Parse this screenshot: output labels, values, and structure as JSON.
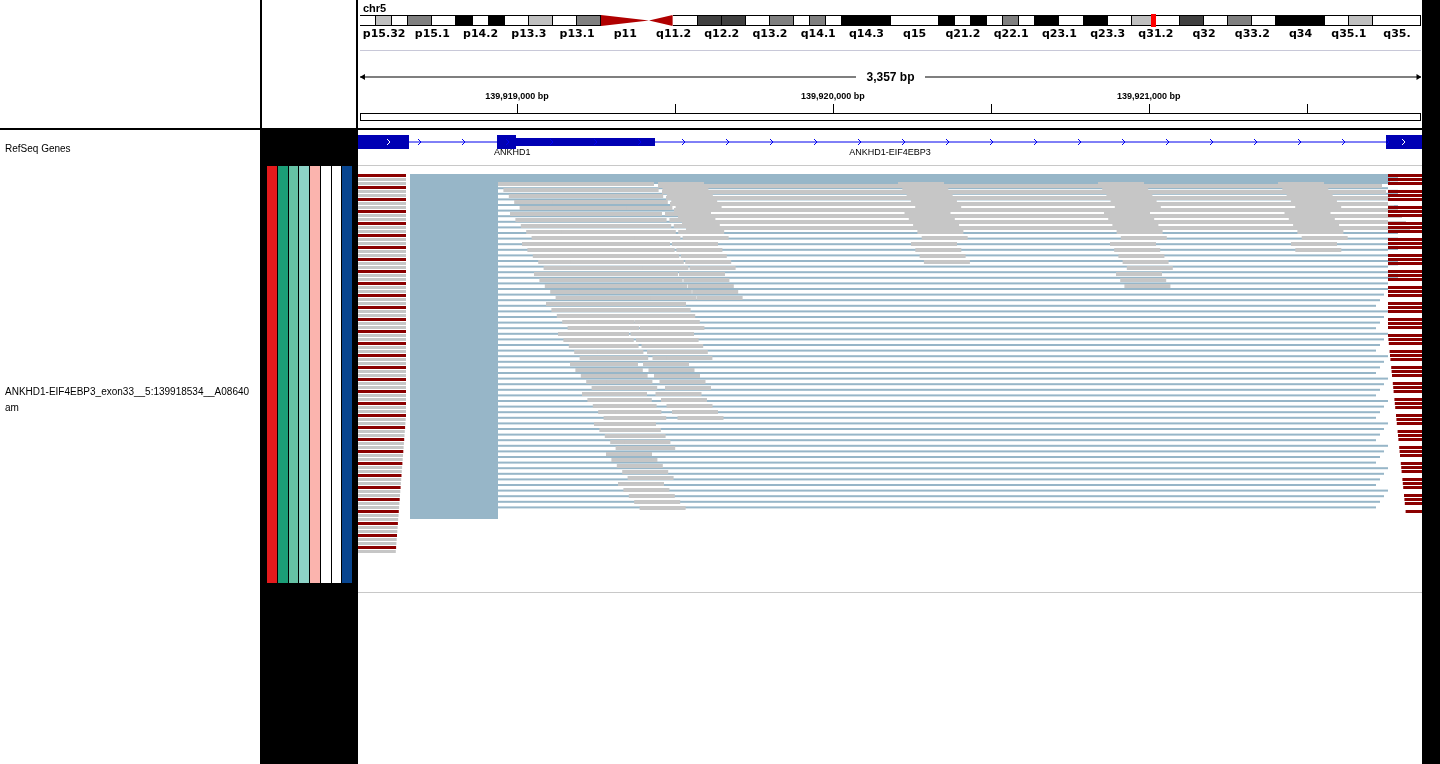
{
  "chromosome": "chr5",
  "cytobands": [
    {
      "label": "p15.32",
      "stains": [
        {
          "kind": "white"
        },
        {
          "kind": "light"
        },
        {
          "kind": "white"
        }
      ],
      "marked": false
    },
    {
      "label": "p15.1",
      "stains": [
        {
          "kind": "gray"
        },
        {
          "kind": "white"
        }
      ],
      "marked": false
    },
    {
      "label": "p14.2",
      "stains": [
        {
          "kind": "black"
        },
        {
          "kind": "white"
        },
        {
          "kind": "black"
        }
      ],
      "marked": false
    },
    {
      "label": "p13.3",
      "stains": [
        {
          "kind": "white"
        },
        {
          "kind": "light"
        }
      ],
      "marked": false
    },
    {
      "label": "p13.1",
      "stains": [
        {
          "kind": "white"
        },
        {
          "kind": "gray"
        }
      ],
      "marked": false
    },
    {
      "label": "p11",
      "stains": [
        {
          "kind": "acen_p"
        }
      ],
      "marked": false
    },
    {
      "label": "q11.2",
      "stains": [
        {
          "kind": "acen_q"
        },
        {
          "kind": "white"
        }
      ],
      "marked": false
    },
    {
      "label": "q12.2",
      "stains": [
        {
          "kind": "dark"
        },
        {
          "kind": "dark"
        }
      ],
      "marked": false
    },
    {
      "label": "q13.2",
      "stains": [
        {
          "kind": "white"
        },
        {
          "kind": "gray"
        }
      ],
      "marked": false
    },
    {
      "label": "q14.1",
      "stains": [
        {
          "kind": "white"
        },
        {
          "kind": "gray"
        },
        {
          "kind": "white"
        }
      ],
      "marked": false
    },
    {
      "label": "q14.3",
      "stains": [
        {
          "kind": "black"
        }
      ],
      "marked": false
    },
    {
      "label": "q15",
      "stains": [
        {
          "kind": "white"
        }
      ],
      "marked": false
    },
    {
      "label": "q21.2",
      "stains": [
        {
          "kind": "black"
        },
        {
          "kind": "white"
        },
        {
          "kind": "black"
        }
      ],
      "marked": false
    },
    {
      "label": "q22.1",
      "stains": [
        {
          "kind": "white"
        },
        {
          "kind": "gray"
        },
        {
          "kind": "white"
        }
      ],
      "marked": false
    },
    {
      "label": "q23.1",
      "stains": [
        {
          "kind": "black"
        },
        {
          "kind": "white"
        }
      ],
      "marked": false
    },
    {
      "label": "q23.3",
      "stains": [
        {
          "kind": "black"
        },
        {
          "kind": "white"
        }
      ],
      "marked": false
    },
    {
      "label": "q31.2",
      "stains": [
        {
          "kind": "light"
        },
        {
          "kind": "white"
        }
      ],
      "marked": true
    },
    {
      "label": "q32",
      "stains": [
        {
          "kind": "dark"
        },
        {
          "kind": "white"
        }
      ],
      "marked": false
    },
    {
      "label": "q33.2",
      "stains": [
        {
          "kind": "gray"
        },
        {
          "kind": "white"
        }
      ],
      "marked": false
    },
    {
      "label": "q34",
      "stains": [
        {
          "kind": "black"
        }
      ],
      "marked": false
    },
    {
      "label": "q35.1",
      "stains": [
        {
          "kind": "white"
        },
        {
          "kind": "light"
        }
      ],
      "marked": false
    },
    {
      "label": "q35.",
      "stains": [
        {
          "kind": "white"
        }
      ],
      "marked": false
    }
  ],
  "span": "3,357 bp",
  "ticks": [
    "139,919,000 bp",
    "139,920,000 bp",
    "139,921,000 bp"
  ],
  "tracks": [
    {
      "kind": "genes",
      "name_lines": [
        "RefSeq Genes"
      ],
      "genes": [
        "ANKHD1",
        "ANKHD1-EIF4EBP3"
      ]
    },
    {
      "kind": "alignments",
      "name_lines": [
        "ANKHD1-EIF4EBP3_exon33__5:139918534__A08640",
        "am"
      ],
      "attributes": [
        {
          "color": "#e41a1c"
        },
        {
          "color": "#1b9e77"
        },
        {
          "color": "#66c2a5"
        },
        {
          "color": "#8dd3c7"
        },
        {
          "color": "#fbb4ae"
        },
        {
          "color": "#ffffff"
        },
        {
          "color": "#ffffff"
        },
        {
          "color": "#08458f"
        }
      ]
    }
  ]
}
